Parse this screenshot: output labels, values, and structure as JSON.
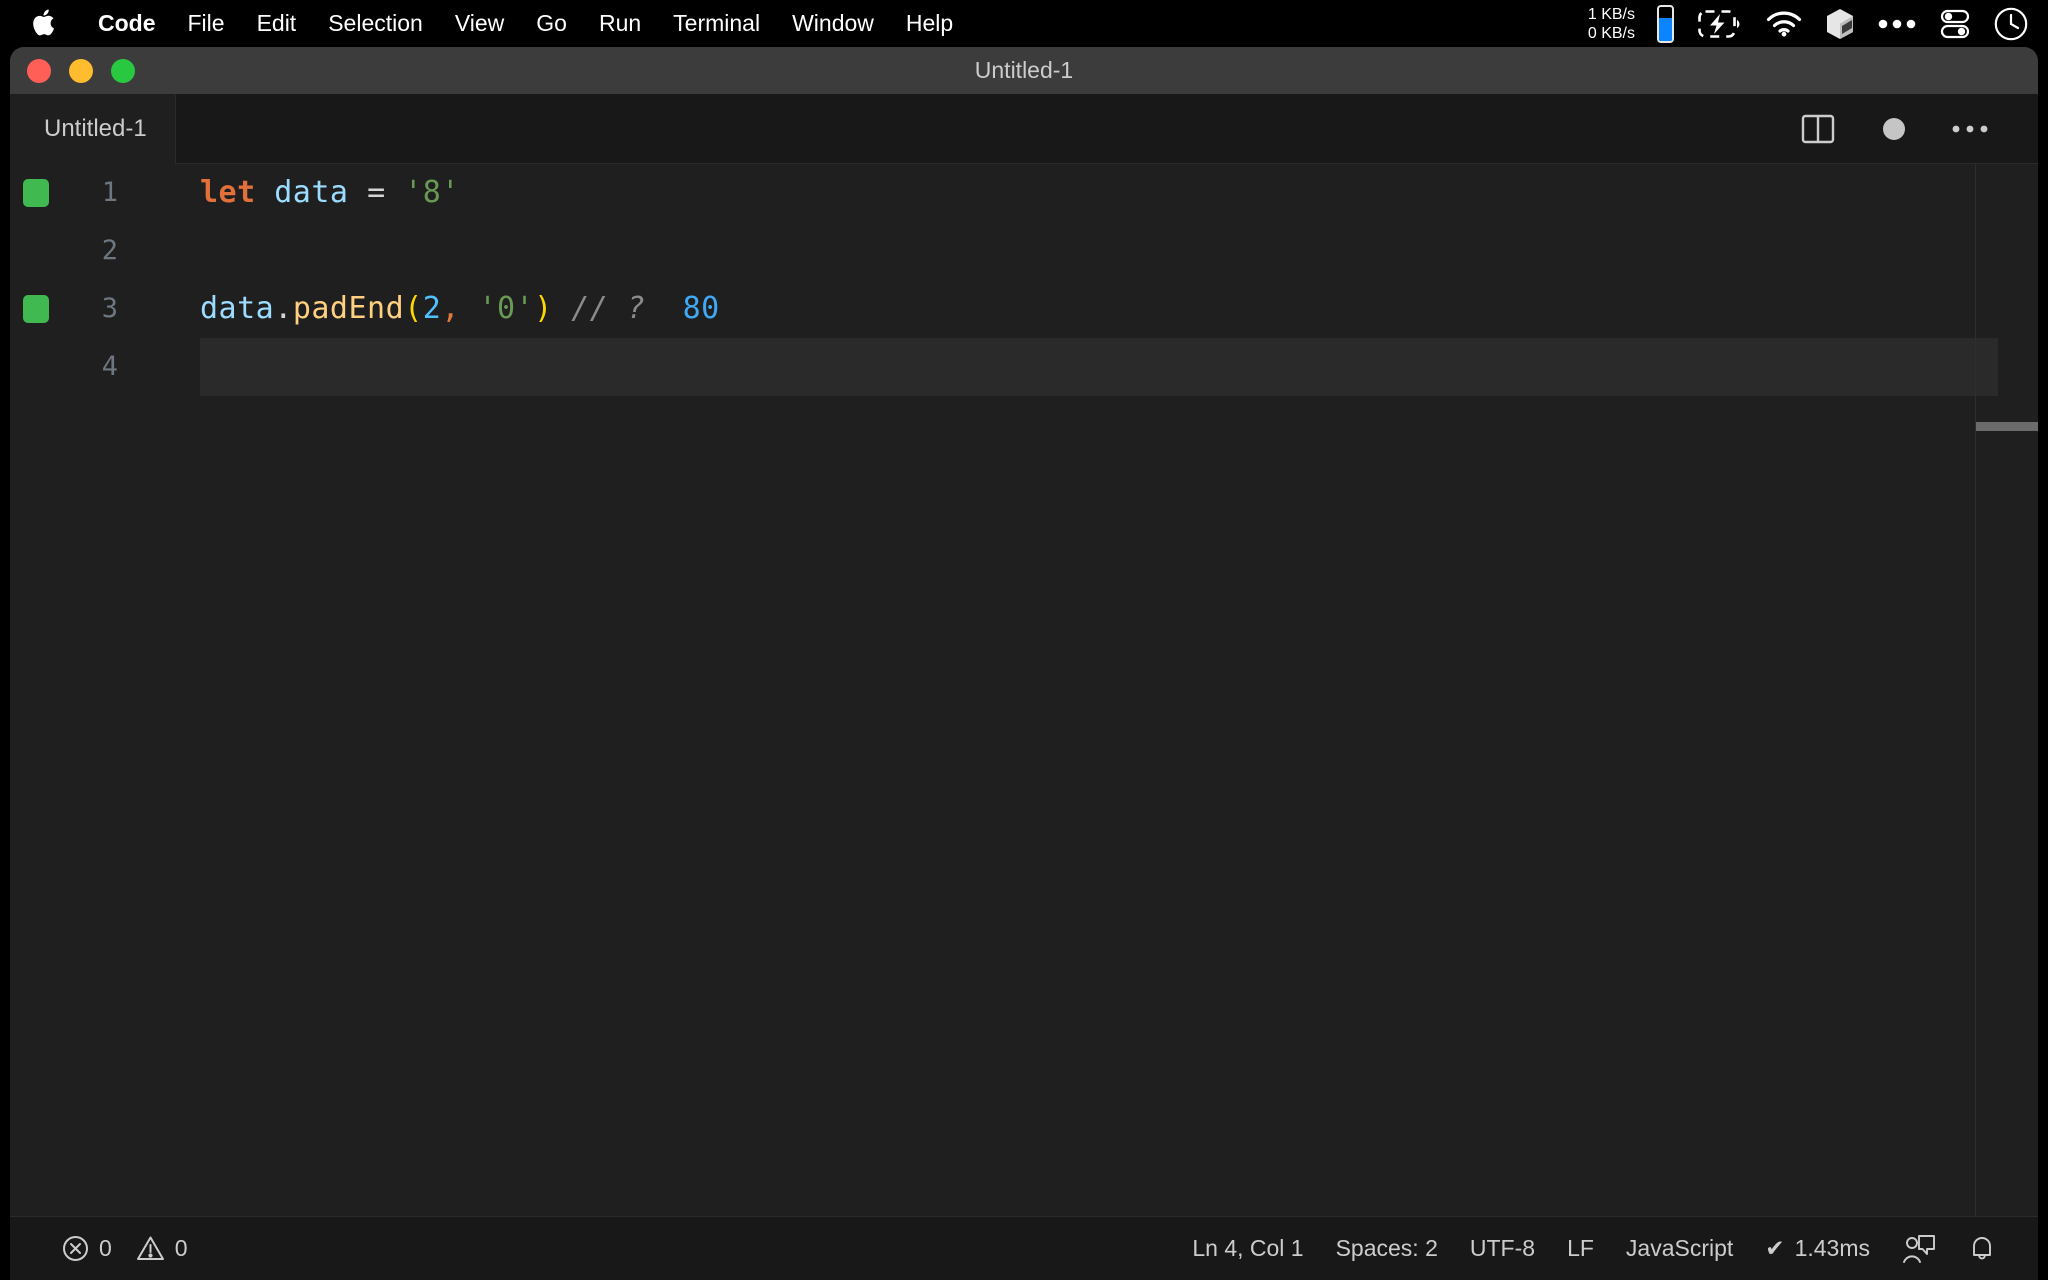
{
  "menubar": {
    "apple_icon": "apple-logo-icon",
    "items": [
      {
        "label": "Code",
        "bold": true
      },
      {
        "label": "File",
        "bold": false
      },
      {
        "label": "Edit",
        "bold": false
      },
      {
        "label": "Selection",
        "bold": false
      },
      {
        "label": "View",
        "bold": false
      },
      {
        "label": "Go",
        "bold": false
      },
      {
        "label": "Run",
        "bold": false
      },
      {
        "label": "Terminal",
        "bold": false
      },
      {
        "label": "Window",
        "bold": false
      },
      {
        "label": "Help",
        "bold": false
      }
    ],
    "network": {
      "down": "1 KB/s",
      "up": "0 KB/s"
    },
    "icons": [
      "battery-pill-icon",
      "battery-charging-icon",
      "wifi-icon",
      "cube-icon",
      "ellipsis-icon",
      "control-center-icon",
      "clock-icon"
    ]
  },
  "window": {
    "title": "Untitled-1",
    "traffic_lights": {
      "close_color": "#ff5f57",
      "minimize_color": "#febc2e",
      "zoom_color": "#28c840"
    }
  },
  "tabbar": {
    "tab_label": "Untitled-1",
    "actions": [
      "split-editor-icon",
      "unsaved-dot-icon",
      "more-actions-icon"
    ]
  },
  "editor": {
    "language": "JavaScript",
    "lines": [
      {
        "number": "1",
        "coverage": true,
        "current": false
      },
      {
        "number": "2",
        "coverage": false,
        "current": false
      },
      {
        "number": "3",
        "coverage": true,
        "current": false
      },
      {
        "number": "4",
        "coverage": false,
        "current": true
      }
    ],
    "code": {
      "line1": {
        "kw": "let",
        "sp1": " ",
        "var": "data",
        "sp2": " ",
        "op": "=",
        "sp3": " ",
        "str": "'8'"
      },
      "line3": {
        "obj": "data",
        "dot": ".",
        "fn": "padEnd",
        "open": "(",
        "num": "2",
        "comma": ",",
        "sp": " ",
        "str": "'0'",
        "close": ")",
        "sp2": " ",
        "comment": "// ?",
        "sp3": "  ",
        "result": "80"
      }
    }
  },
  "statusbar": {
    "errors": "0",
    "warnings": "0",
    "cursor": "Ln 4, Col 1",
    "indent": "Spaces: 2",
    "encoding": "UTF-8",
    "eol": "LF",
    "language": "JavaScript",
    "runtime": "1.43ms",
    "runtime_check": "✔",
    "icons": [
      "error-icon",
      "warning-icon",
      "feedback-icon",
      "bell-icon"
    ]
  },
  "colors": {
    "accent_green": "#3fb950",
    "accent_blue": "#0a84ff",
    "keyword": "#e2703a",
    "string": "#6a9955",
    "number": "#4fc1ff",
    "function": "#ffd080",
    "bracket": "#ffd700",
    "comment": "#8b8b8b",
    "result": "#3fa9f5",
    "editor_bg": "#1f1f1f",
    "titlebar_bg": "#3c3c3c",
    "statusbar_bg": "#181818"
  }
}
